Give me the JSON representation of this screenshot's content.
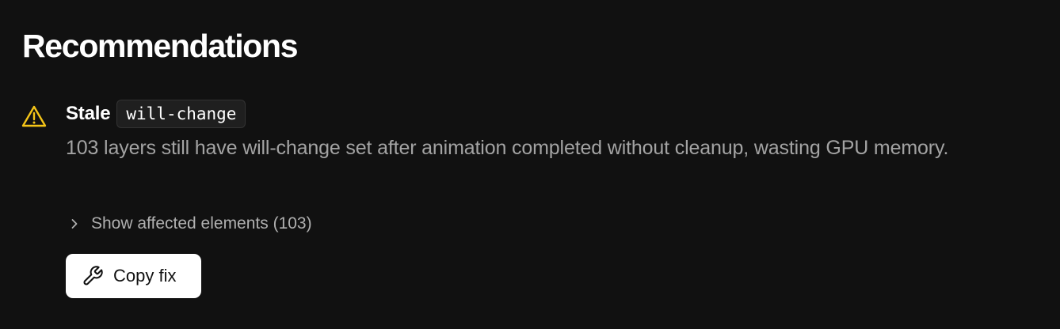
{
  "page": {
    "title": "Recommendations"
  },
  "recommendations": [
    {
      "severity_icon": "warning-triangle-icon",
      "title_prefix": "Stale",
      "title_code": "will-change",
      "description": "103 layers still have will-change set after animation completed without cleanup, wasting GPU memory.",
      "disclosure_icon": "chevron-right-icon",
      "disclosure_label": "Show affected elements (103)",
      "action_icon": "wrench-icon",
      "action_label": "Copy fix"
    }
  ],
  "colors": {
    "background": "#111111",
    "warning": "#f5c518",
    "text_primary": "#ffffff",
    "text_secondary": "#a3a3a3",
    "button_background": "#ffffff",
    "button_text": "#111111"
  }
}
